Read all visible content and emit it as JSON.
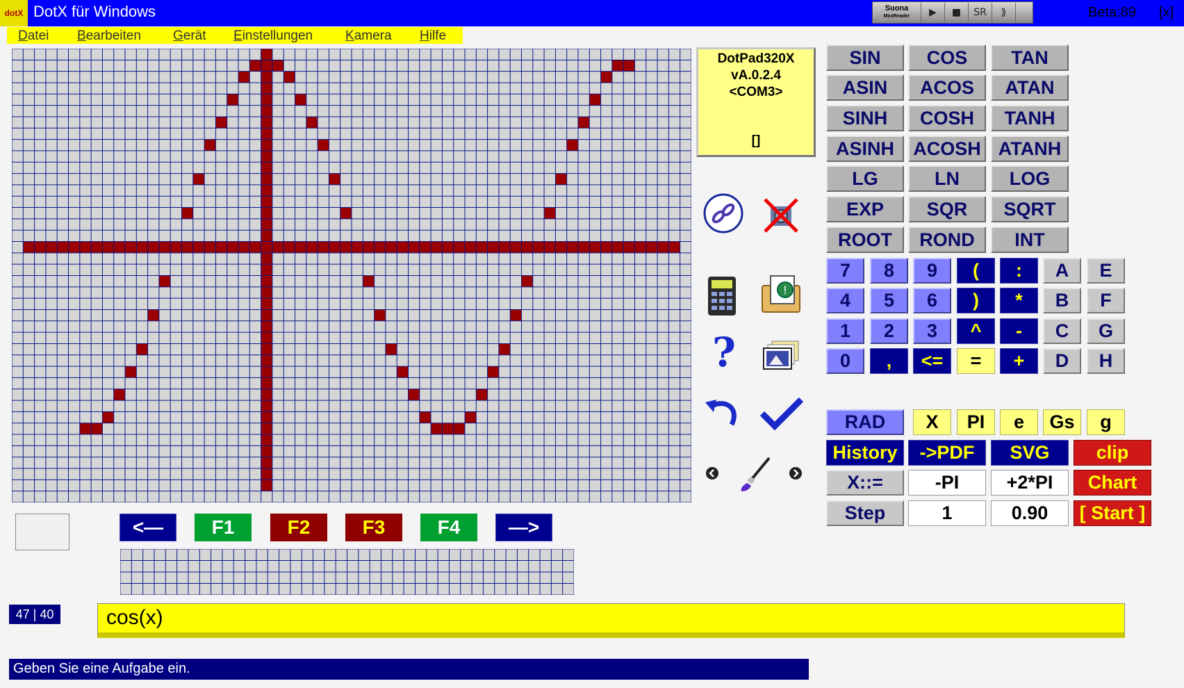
{
  "titlebar": {
    "logo_text": "dotX",
    "title": "DotX für Windows",
    "suona_brand": "Suona",
    "suona_sub": "MiniReader",
    "suona_buttons": [
      "▶",
      "■",
      "SR",
      "⟫"
    ],
    "beta": "Beta:89",
    "close": "[x]"
  },
  "menu": {
    "items": [
      "Datei",
      "Bearbeiten",
      "Gerät",
      "Einstellungen",
      "Kamera",
      "Hilfe"
    ]
  },
  "graph": {
    "function": "cos(x)",
    "cols": 60,
    "rows": 40,
    "colors": {
      "background": "#d6d6d6",
      "gridline": "#0a1a8a",
      "dot": "#9a0000"
    }
  },
  "device": {
    "name": "DotPad320X",
    "version": "vA.0.2.4",
    "port": "<COM3>",
    "brackets": "[]"
  },
  "icons": [
    "link-icon",
    "camera-disabled-icon",
    "calculator-icon",
    "open-folder-icon",
    "help-icon",
    "images-icon",
    "undo-icon",
    "check-icon",
    "prev-arrow-icon",
    "brush-icon",
    "next-arrow-icon"
  ],
  "functions": [
    [
      "SIN",
      "COS",
      "TAN"
    ],
    [
      "ASIN",
      "ACOS",
      "ATAN"
    ],
    [
      "SINH",
      "COSH",
      "TANH"
    ],
    [
      "ASINH",
      "ACOSH",
      "ATANH"
    ],
    [
      "LG",
      "LN",
      "LOG"
    ],
    [
      "EXP",
      "SQR",
      "SQRT"
    ],
    [
      "ROOT",
      "ROND",
      "INT"
    ]
  ],
  "keypad": [
    [
      "7",
      "8",
      "9",
      "(",
      ":",
      "A",
      "E"
    ],
    [
      "4",
      "5",
      "6",
      ")",
      "*",
      "B",
      "F"
    ],
    [
      "1",
      "2",
      "3",
      "^",
      "-",
      "C",
      "G"
    ],
    [
      "0",
      ",",
      "<=",
      "=",
      "+",
      "D",
      "H"
    ]
  ],
  "controls": {
    "rad": "RAD",
    "x": "X",
    "pi": "PI",
    "e": "e",
    "gs": "Gs",
    "g": "g",
    "history": "History",
    "pdf": "->PDF",
    "svg": "SVG",
    "clip": "clip",
    "x_assign": "X::=",
    "x_min": "-PI",
    "x_max": "+2*PI",
    "chart": "Chart",
    "step": "Step",
    "step_value": "1",
    "scale_value": "0.90",
    "start": "[ Start ]"
  },
  "nav": {
    "back": "<—",
    "f1": "F1",
    "f2": "F2",
    "f3": "F3",
    "f4": "F4",
    "forward": "—>"
  },
  "position": "47 | 40",
  "formula": "cos(x)",
  "status": "Geben Sie eine Aufgabe ein."
}
